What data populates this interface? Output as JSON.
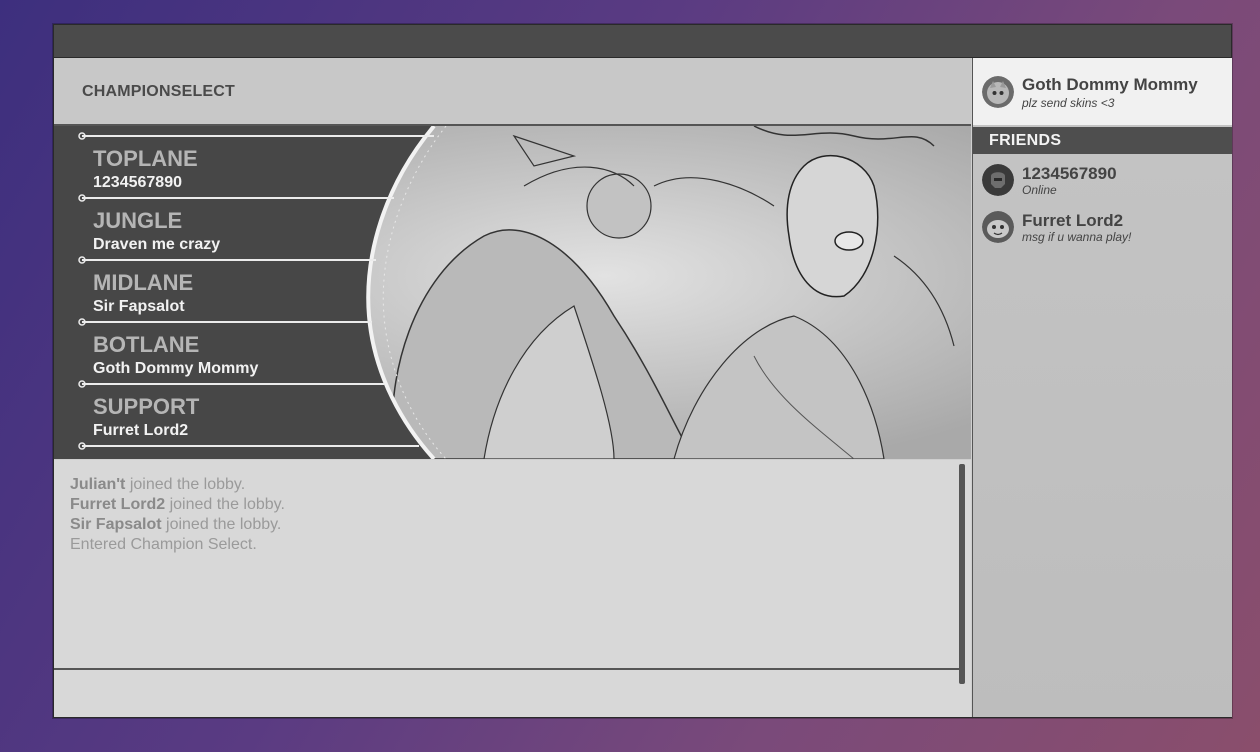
{
  "header": {
    "title": "CHAMPIONSELECT"
  },
  "lanes": [
    {
      "role": "TOPLANE",
      "player": "1234567890"
    },
    {
      "role": "JUNGLE",
      "player": "Draven me crazy"
    },
    {
      "role": "MIDLANE",
      "player": "Sir Fapsalot"
    },
    {
      "role": "BOTLANE",
      "player": "Goth Dommy Mommy"
    },
    {
      "role": "SUPPORT",
      "player": "Furret Lord2"
    }
  ],
  "chat": {
    "messages": [
      {
        "name": "Julian't",
        "text": " joined the lobby."
      },
      {
        "name": "Furret Lord2",
        "text": " joined the lobby."
      },
      {
        "name": "Sir Fapsalot",
        "text": " joined the lobby."
      },
      {
        "name": "",
        "text": "Entered Champion Select."
      }
    ]
  },
  "profile": {
    "name": "Goth Dommy Mommy",
    "status": "plz send skins <3"
  },
  "friends": {
    "header": "FRIENDS",
    "items": [
      {
        "name": "1234567890",
        "status": "Online"
      },
      {
        "name": "Furret Lord2",
        "status": "msg if u wanna play!"
      }
    ]
  }
}
